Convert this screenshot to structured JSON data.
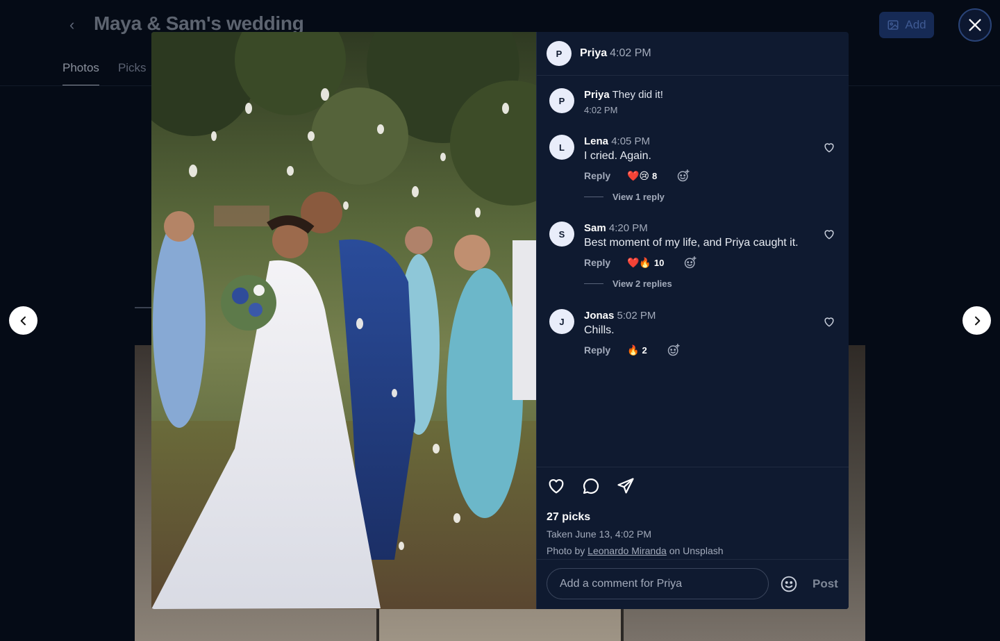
{
  "page": {
    "title": "Maya & Sam's wedding",
    "tabs": [
      "Photos",
      "Picks"
    ],
    "add_label": "Add"
  },
  "post": {
    "author": "Priya",
    "author_initial": "P",
    "time": "4:02 PM"
  },
  "comments": [
    {
      "initial": "P",
      "name": "Priya",
      "text": "They did it!",
      "time": "4:02 PM"
    },
    {
      "initial": "L",
      "name": "Lena",
      "time": "4:05 PM",
      "text": "I cried. Again.",
      "reply_label": "Reply",
      "reactions_emoji": "❤️😢",
      "reactions_count": "8",
      "view_replies": "View 1 reply"
    },
    {
      "initial": "S",
      "name": "Sam",
      "time": "4:20 PM",
      "text": "Best moment of my life, and Priya caught it.",
      "reply_label": "Reply",
      "reactions_emoji": "❤️🔥",
      "reactions_count": "10",
      "view_replies": "View 2 replies"
    },
    {
      "initial": "J",
      "name": "Jonas",
      "time": "5:02 PM",
      "text": "Chills.",
      "reply_label": "Reply",
      "reactions_emoji": "🔥",
      "reactions_count": "2"
    }
  ],
  "footer": {
    "picks": "27 picks",
    "taken": "Taken June 13, 4:02 PM",
    "credit_prefix": "Photo by",
    "credit_name": "Leonardo Miranda",
    "credit_suffix": "on Unsplash"
  },
  "compose": {
    "placeholder": "Add a comment for Priya",
    "post_label": "Post"
  },
  "icons": {
    "close": "close-icon",
    "prev": "chevron-left-icon",
    "next": "chevron-right-icon",
    "heart": "heart-icon",
    "comment": "comment-icon",
    "share": "send-icon",
    "emoji": "smiley-icon",
    "add_reaction": "add-reaction-icon"
  },
  "colors": {
    "background": "#050b16",
    "panel": "#0f1a30",
    "accent": "#162a55"
  }
}
